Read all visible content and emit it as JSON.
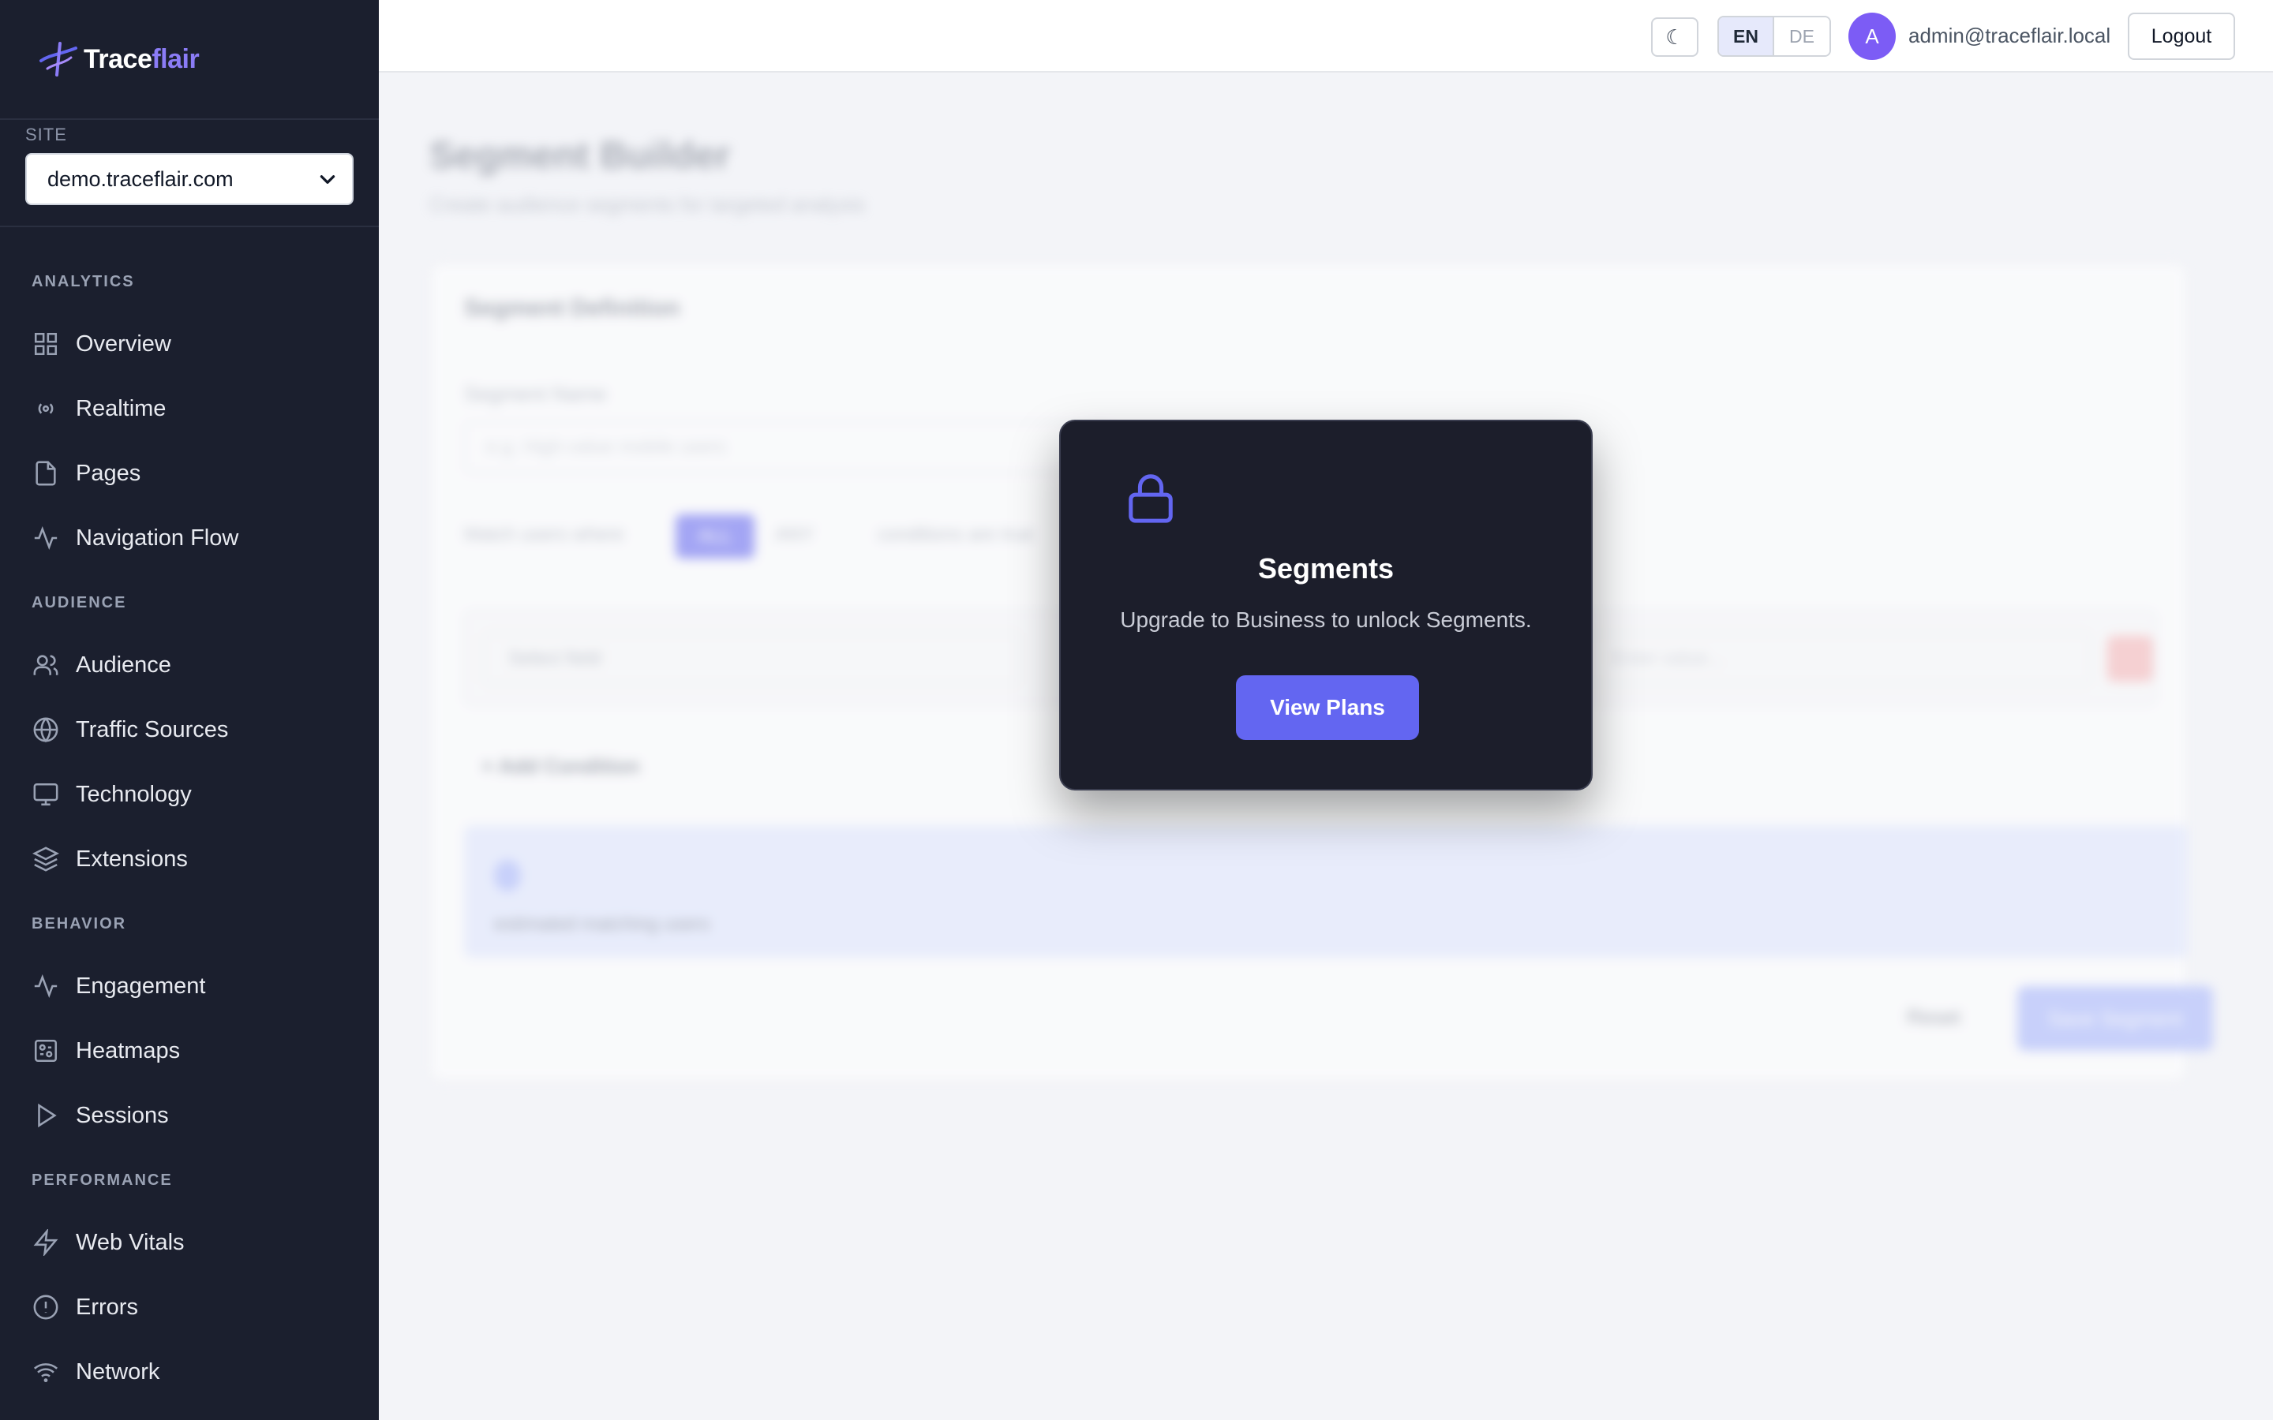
{
  "brand": {
    "name_part1": "Trace",
    "name_part2": "flair"
  },
  "site": {
    "label": "SITE",
    "selected": "demo.traceflair.com"
  },
  "sidebar": {
    "sections": [
      {
        "title": "ANALYTICS",
        "items": [
          {
            "label": "Overview",
            "icon": "grid-icon"
          },
          {
            "label": "Realtime",
            "icon": "broadcast-icon"
          },
          {
            "label": "Pages",
            "icon": "file-icon"
          },
          {
            "label": "Navigation Flow",
            "icon": "activity-icon"
          }
        ]
      },
      {
        "title": "AUDIENCE",
        "items": [
          {
            "label": "Audience",
            "icon": "users-icon"
          },
          {
            "label": "Traffic Sources",
            "icon": "globe-icon"
          },
          {
            "label": "Technology",
            "icon": "monitor-icon"
          },
          {
            "label": "Extensions",
            "icon": "layers-icon"
          }
        ]
      },
      {
        "title": "BEHAVIOR",
        "items": [
          {
            "label": "Engagement",
            "icon": "activity-icon"
          },
          {
            "label": "Heatmaps",
            "icon": "heatmap-icon"
          },
          {
            "label": "Sessions",
            "icon": "play-icon"
          }
        ]
      },
      {
        "title": "PERFORMANCE",
        "items": [
          {
            "label": "Web Vitals",
            "icon": "zap-icon"
          },
          {
            "label": "Errors",
            "icon": "alert-circle-icon"
          },
          {
            "label": "Network",
            "icon": "wifi-icon"
          }
        ]
      }
    ]
  },
  "topbar": {
    "theme_toggle": "☾",
    "lang_active": "EN",
    "lang_inactive": "DE",
    "avatar_letter": "A",
    "user_email": "admin@traceflair.local",
    "logout_label": "Logout"
  },
  "background": {
    "page_title": "Segment Builder",
    "page_subtitle": "Create audience segments for targeted analysis",
    "card_title": "Segment Definition",
    "name_label": "Segment Name",
    "name_placeholder": "e.g. High-value mobile users",
    "match_label": "Match users where",
    "match_all": "ALL",
    "match_any": "ANY",
    "match_note": "conditions are true",
    "cond_select": "Select field",
    "cond_value": "Enter value...",
    "add_condition": "+ Add Condition",
    "info_text": "estimated matching users",
    "reset_label": "Reset",
    "save_label": "Save Segment"
  },
  "modal": {
    "title": "Segments",
    "message": "Upgrade to Business to unlock Segments.",
    "button_label": "View Plans",
    "icon": "lock-icon"
  },
  "colors": {
    "sidebar_bg": "#1b1f2e",
    "accent": "#6366f1",
    "brand_accent": "#8b7cf6",
    "modal_bg": "#1c1e2b"
  }
}
